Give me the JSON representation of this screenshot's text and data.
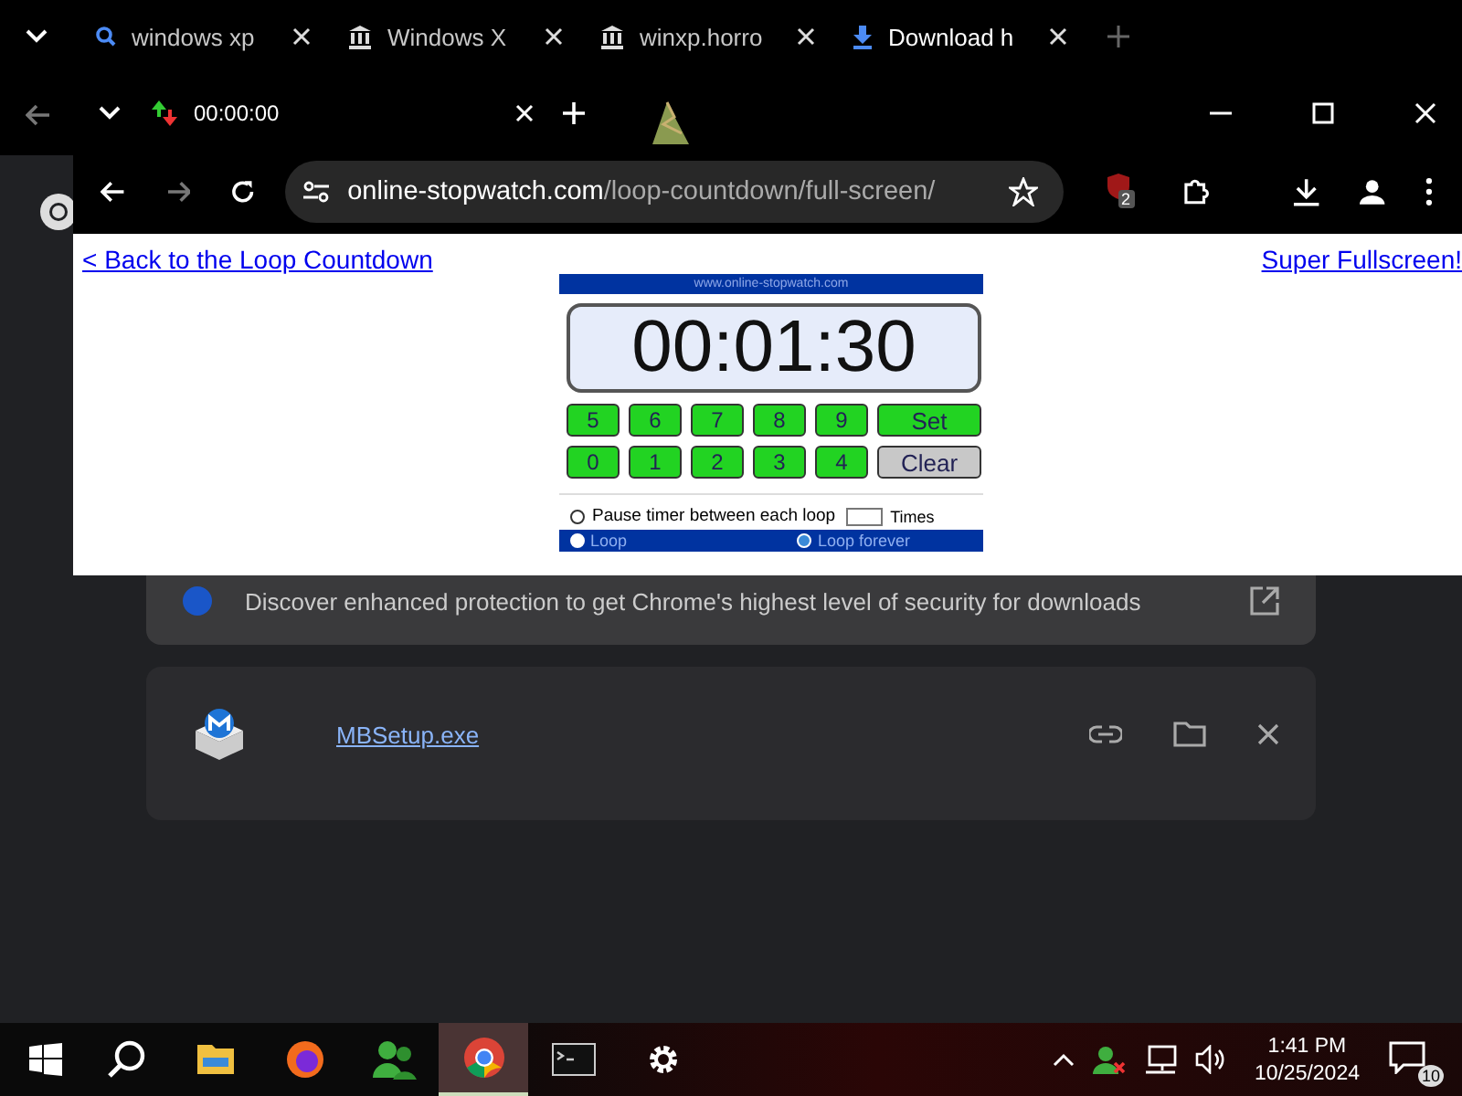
{
  "back_window": {
    "tabs": [
      {
        "title": "windows xp",
        "kind": "search",
        "selected": false
      },
      {
        "title": "Windows X",
        "kind": "building",
        "selected": false
      },
      {
        "title": "winxp.horro",
        "kind": "building",
        "selected": false
      },
      {
        "title": "Download h",
        "kind": "download",
        "selected": true
      }
    ]
  },
  "downloads": {
    "banner": "Discover enhanced protection to get Chrome's highest level of security for downloads",
    "items": [
      {
        "file": "MBSetup.exe"
      }
    ]
  },
  "front_window": {
    "tab_title": "00:00:00",
    "url_host": "online-stopwatch.com",
    "url_path": "/loop-countdown/full-screen/",
    "extension_badge": "2",
    "page": {
      "back_link": "< Back to the Loop Countdown",
      "fullscreen_link": "Super Fullscreen!",
      "site_banner": "www.online-stopwatch.com",
      "display": "00:01:30",
      "keys": [
        {
          "label": "5",
          "kind": "digit"
        },
        {
          "label": "6",
          "kind": "digit"
        },
        {
          "label": "7",
          "kind": "digit"
        },
        {
          "label": "8",
          "kind": "digit"
        },
        {
          "label": "9",
          "kind": "digit"
        },
        {
          "label": "Set",
          "kind": "set"
        },
        {
          "label": "0",
          "kind": "digit"
        },
        {
          "label": "1",
          "kind": "digit"
        },
        {
          "label": "2",
          "kind": "digit"
        },
        {
          "label": "3",
          "kind": "digit"
        },
        {
          "label": "4",
          "kind": "digit"
        },
        {
          "label": "Clear",
          "kind": "clear"
        }
      ],
      "pause_option": {
        "label": "Pause timer between each loop",
        "checked": false
      },
      "times_label": "Times",
      "loop_options": [
        {
          "label": "Loop",
          "selected": false
        },
        {
          "label": "Loop forever",
          "selected": true
        }
      ]
    }
  },
  "taskbar": {
    "apps": [
      {
        "kind": "search",
        "selected": false
      },
      {
        "kind": "folder",
        "selected": false
      },
      {
        "kind": "firefox",
        "selected": false
      },
      {
        "kind": "people",
        "selected": false
      },
      {
        "kind": "chrome",
        "selected": true
      },
      {
        "kind": "terminal",
        "selected": false
      },
      {
        "kind": "settings",
        "selected": false
      }
    ],
    "time": "1:41 PM",
    "date": "10/25/2024",
    "notification_count": "10"
  }
}
